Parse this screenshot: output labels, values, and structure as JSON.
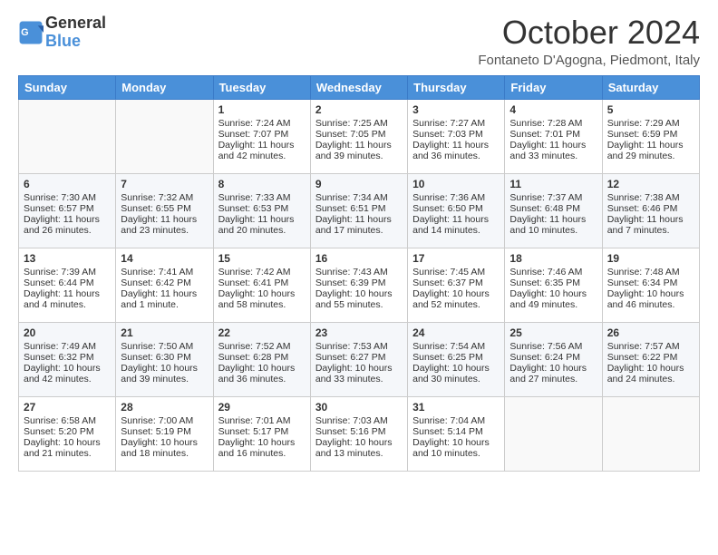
{
  "header": {
    "logo_general": "General",
    "logo_blue": "Blue",
    "month": "October 2024",
    "location": "Fontaneto D'Agogna, Piedmont, Italy"
  },
  "days_of_week": [
    "Sunday",
    "Monday",
    "Tuesday",
    "Wednesday",
    "Thursday",
    "Friday",
    "Saturday"
  ],
  "weeks": [
    [
      {
        "day": "",
        "info": ""
      },
      {
        "day": "",
        "info": ""
      },
      {
        "day": "1",
        "info": "Sunrise: 7:24 AM\nSunset: 7:07 PM\nDaylight: 11 hours and 42 minutes."
      },
      {
        "day": "2",
        "info": "Sunrise: 7:25 AM\nSunset: 7:05 PM\nDaylight: 11 hours and 39 minutes."
      },
      {
        "day": "3",
        "info": "Sunrise: 7:27 AM\nSunset: 7:03 PM\nDaylight: 11 hours and 36 minutes."
      },
      {
        "day": "4",
        "info": "Sunrise: 7:28 AM\nSunset: 7:01 PM\nDaylight: 11 hours and 33 minutes."
      },
      {
        "day": "5",
        "info": "Sunrise: 7:29 AM\nSunset: 6:59 PM\nDaylight: 11 hours and 29 minutes."
      }
    ],
    [
      {
        "day": "6",
        "info": "Sunrise: 7:30 AM\nSunset: 6:57 PM\nDaylight: 11 hours and 26 minutes."
      },
      {
        "day": "7",
        "info": "Sunrise: 7:32 AM\nSunset: 6:55 PM\nDaylight: 11 hours and 23 minutes."
      },
      {
        "day": "8",
        "info": "Sunrise: 7:33 AM\nSunset: 6:53 PM\nDaylight: 11 hours and 20 minutes."
      },
      {
        "day": "9",
        "info": "Sunrise: 7:34 AM\nSunset: 6:51 PM\nDaylight: 11 hours and 17 minutes."
      },
      {
        "day": "10",
        "info": "Sunrise: 7:36 AM\nSunset: 6:50 PM\nDaylight: 11 hours and 14 minutes."
      },
      {
        "day": "11",
        "info": "Sunrise: 7:37 AM\nSunset: 6:48 PM\nDaylight: 11 hours and 10 minutes."
      },
      {
        "day": "12",
        "info": "Sunrise: 7:38 AM\nSunset: 6:46 PM\nDaylight: 11 hours and 7 minutes."
      }
    ],
    [
      {
        "day": "13",
        "info": "Sunrise: 7:39 AM\nSunset: 6:44 PM\nDaylight: 11 hours and 4 minutes."
      },
      {
        "day": "14",
        "info": "Sunrise: 7:41 AM\nSunset: 6:42 PM\nDaylight: 11 hours and 1 minute."
      },
      {
        "day": "15",
        "info": "Sunrise: 7:42 AM\nSunset: 6:41 PM\nDaylight: 10 hours and 58 minutes."
      },
      {
        "day": "16",
        "info": "Sunrise: 7:43 AM\nSunset: 6:39 PM\nDaylight: 10 hours and 55 minutes."
      },
      {
        "day": "17",
        "info": "Sunrise: 7:45 AM\nSunset: 6:37 PM\nDaylight: 10 hours and 52 minutes."
      },
      {
        "day": "18",
        "info": "Sunrise: 7:46 AM\nSunset: 6:35 PM\nDaylight: 10 hours and 49 minutes."
      },
      {
        "day": "19",
        "info": "Sunrise: 7:48 AM\nSunset: 6:34 PM\nDaylight: 10 hours and 46 minutes."
      }
    ],
    [
      {
        "day": "20",
        "info": "Sunrise: 7:49 AM\nSunset: 6:32 PM\nDaylight: 10 hours and 42 minutes."
      },
      {
        "day": "21",
        "info": "Sunrise: 7:50 AM\nSunset: 6:30 PM\nDaylight: 10 hours and 39 minutes."
      },
      {
        "day": "22",
        "info": "Sunrise: 7:52 AM\nSunset: 6:28 PM\nDaylight: 10 hours and 36 minutes."
      },
      {
        "day": "23",
        "info": "Sunrise: 7:53 AM\nSunset: 6:27 PM\nDaylight: 10 hours and 33 minutes."
      },
      {
        "day": "24",
        "info": "Sunrise: 7:54 AM\nSunset: 6:25 PM\nDaylight: 10 hours and 30 minutes."
      },
      {
        "day": "25",
        "info": "Sunrise: 7:56 AM\nSunset: 6:24 PM\nDaylight: 10 hours and 27 minutes."
      },
      {
        "day": "26",
        "info": "Sunrise: 7:57 AM\nSunset: 6:22 PM\nDaylight: 10 hours and 24 minutes."
      }
    ],
    [
      {
        "day": "27",
        "info": "Sunrise: 6:58 AM\nSunset: 5:20 PM\nDaylight: 10 hours and 21 minutes."
      },
      {
        "day": "28",
        "info": "Sunrise: 7:00 AM\nSunset: 5:19 PM\nDaylight: 10 hours and 18 minutes."
      },
      {
        "day": "29",
        "info": "Sunrise: 7:01 AM\nSunset: 5:17 PM\nDaylight: 10 hours and 16 minutes."
      },
      {
        "day": "30",
        "info": "Sunrise: 7:03 AM\nSunset: 5:16 PM\nDaylight: 10 hours and 13 minutes."
      },
      {
        "day": "31",
        "info": "Sunrise: 7:04 AM\nSunset: 5:14 PM\nDaylight: 10 hours and 10 minutes."
      },
      {
        "day": "",
        "info": ""
      },
      {
        "day": "",
        "info": ""
      }
    ]
  ]
}
